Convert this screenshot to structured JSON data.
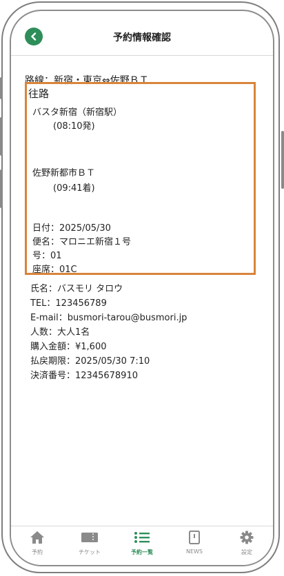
{
  "header": {
    "title": "予約情報確認"
  },
  "route": "路線：新宿・東京⇔佐野ＢＴ",
  "trip": {
    "heading": "往路",
    "departure": {
      "name": "バスタ新宿（新宿駅）",
      "time": "(08:10発)"
    },
    "arrival": {
      "name": "佐野新都市ＢＴ",
      "time": "(09:41着)"
    },
    "details": [
      "日付：2025/05/30",
      "便名：マロニエ新宿１号",
      "号：01",
      "座席：01C"
    ]
  },
  "passenger": [
    "氏名：バスモリ タロウ",
    "TEL：123456789",
    "E-mail：busmori-tarou@busmori.jp",
    "人数：大人1名",
    "購入金額：¥1,600",
    "払戻期限：2025/05/30 7:10",
    "決済番号：12345678910"
  ],
  "tabs": [
    {
      "label": "予約",
      "icon": "home-icon"
    },
    {
      "label": "チケット",
      "icon": "ticket-icon"
    },
    {
      "label": "予約一覧",
      "icon": "list-icon",
      "active": true
    },
    {
      "label": "NEWS",
      "icon": "news-icon"
    },
    {
      "label": "設定",
      "icon": "gear-icon"
    }
  ],
  "colors": {
    "accent": "#2e8e5a",
    "highlight_border": "#d9843a"
  }
}
